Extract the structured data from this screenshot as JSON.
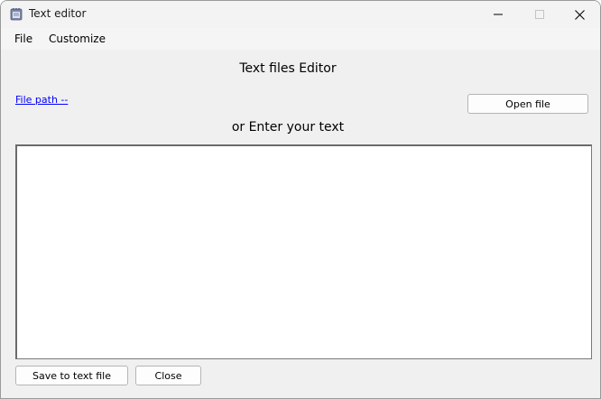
{
  "window": {
    "title": "Text editor",
    "icon": "notepad-icon",
    "controls": {
      "minimize": "minimize-icon",
      "maximize": "maximize-icon",
      "close": "close-icon"
    }
  },
  "menu": {
    "items": [
      {
        "label": "File"
      },
      {
        "label": "Customize"
      }
    ]
  },
  "main": {
    "heading": "Text files Editor",
    "file_path_label": "File path --",
    "open_file_label": "Open file",
    "subheading": "or Enter your text",
    "editor": {
      "value": "",
      "placeholder": ""
    },
    "save_label": "Save to text file",
    "close_label": "Close"
  },
  "colors": {
    "link": "#0000ff",
    "window_bg": "#f0f0f0",
    "editor_bg": "#ffffff"
  }
}
